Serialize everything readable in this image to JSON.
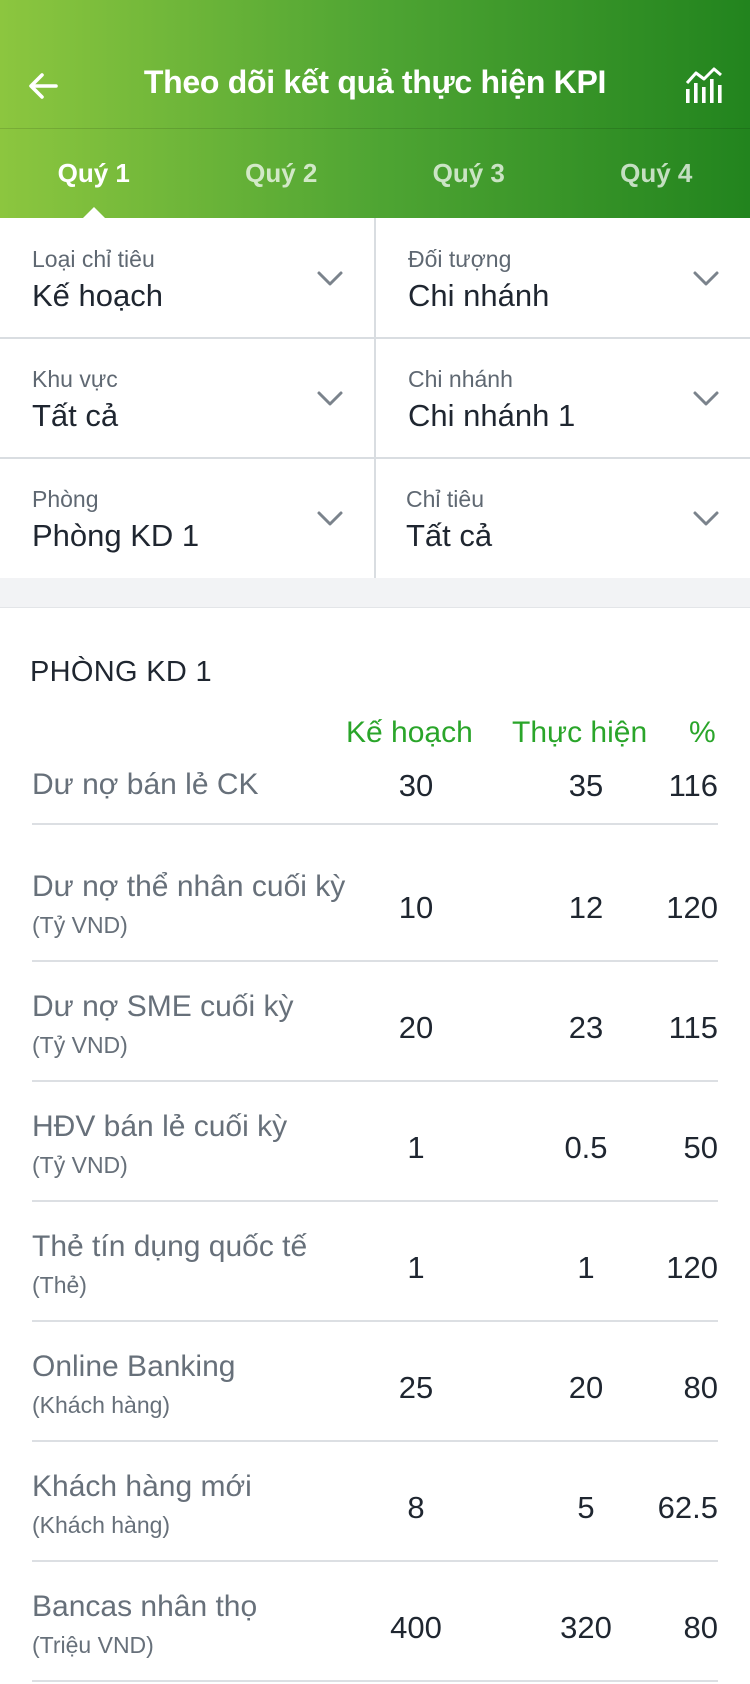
{
  "header": {
    "title": "Theo dõi kết quả thực hiện KPI",
    "back_icon": "arrow-left-icon",
    "chart_icon": "bar-chart-icon",
    "gradient": [
      "#8cc63f",
      "#22841e"
    ]
  },
  "tabs": [
    {
      "label": "Quý 1",
      "active": true
    },
    {
      "label": "Quý 2",
      "active": false
    },
    {
      "label": "Quý 3",
      "active": false
    },
    {
      "label": "Quý 4",
      "active": false
    }
  ],
  "filters": [
    {
      "label": "Loại chỉ tiêu",
      "value": "Kế hoạch"
    },
    {
      "label": "Đối tượng",
      "value": "Chi nhánh"
    },
    {
      "label": "Khu vực",
      "value": "Tất cả"
    },
    {
      "label": "Chi nhánh",
      "value": "Chi nhánh 1"
    },
    {
      "label": "Phòng",
      "value": "Phòng KD 1"
    },
    {
      "label": "Chỉ tiêu",
      "value": "Tất cả"
    }
  ],
  "section": {
    "title": "PHÒNG KD 1",
    "columns": {
      "plan": "Kế hoạch",
      "actual": "Thực hiện",
      "percent": "%"
    },
    "accent_color": "#2aa52a"
  },
  "rows": [
    {
      "name": "Dư nợ bán lẻ CK",
      "unit": "",
      "plan": "30",
      "actual": "35",
      "percent": "116"
    },
    {
      "name": "Dư nợ thể nhân cuối kỳ",
      "unit": "(Tỷ VND)",
      "plan": "10",
      "actual": "12",
      "percent": "120"
    },
    {
      "name": "Dư nợ SME cuối kỳ",
      "unit": "(Tỷ VND)",
      "plan": "20",
      "actual": "23",
      "percent": "115"
    },
    {
      "name": "HĐV bán lẻ cuối kỳ",
      "unit": "(Tỷ VND)",
      "plan": "1",
      "actual": "0.5",
      "percent": "50"
    },
    {
      "name": "Thẻ tín dụng quốc tế",
      "unit": "(Thẻ)",
      "plan": "1",
      "actual": "1",
      "percent": "120"
    },
    {
      "name": "Online Banking",
      "unit": "(Khách hàng)",
      "plan": "25",
      "actual": "20",
      "percent": "80"
    },
    {
      "name": "Khách hàng mới",
      "unit": "(Khách hàng)",
      "plan": "8",
      "actual": "5",
      "percent": "62.5"
    },
    {
      "name": "Bancas nhân thọ",
      "unit": "(Triệu VND)",
      "plan": "400",
      "actual": "320",
      "percent": "80"
    }
  ]
}
